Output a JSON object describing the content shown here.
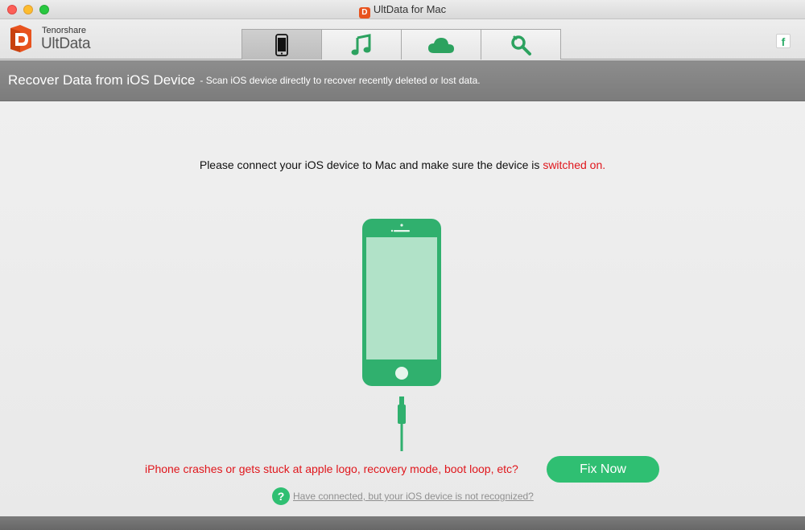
{
  "window": {
    "title": "UltData for Mac"
  },
  "brand": {
    "company": "Tenorshare",
    "product": "UltData",
    "accent": "#2fbf72",
    "logo_color": "#e8531e"
  },
  "tabs": [
    {
      "name": "ios-device",
      "icon": "phone-icon",
      "active": true
    },
    {
      "name": "itunes-backup",
      "icon": "music-note-icon",
      "active": false
    },
    {
      "name": "icloud-backup",
      "icon": "cloud-icon",
      "active": false
    },
    {
      "name": "repair",
      "icon": "wrench-search-icon",
      "active": false
    }
  ],
  "header": {
    "title": "Recover Data from iOS Device",
    "subtitle": "- Scan iOS device directly to recover recently deleted or lost data."
  },
  "main": {
    "instruction_prefix": "Please connect your iOS device to Mac and make sure the device is ",
    "instruction_highlight": "switched on.",
    "crash_text": "iPhone crashes or gets stuck at apple logo, recovery mode, boot loop, etc?",
    "fix_button": "Fix Now",
    "help_icon": "?",
    "help_link": "Have connected, but your iOS device is not recognized?"
  },
  "social": {
    "facebook_glyph": "f"
  }
}
